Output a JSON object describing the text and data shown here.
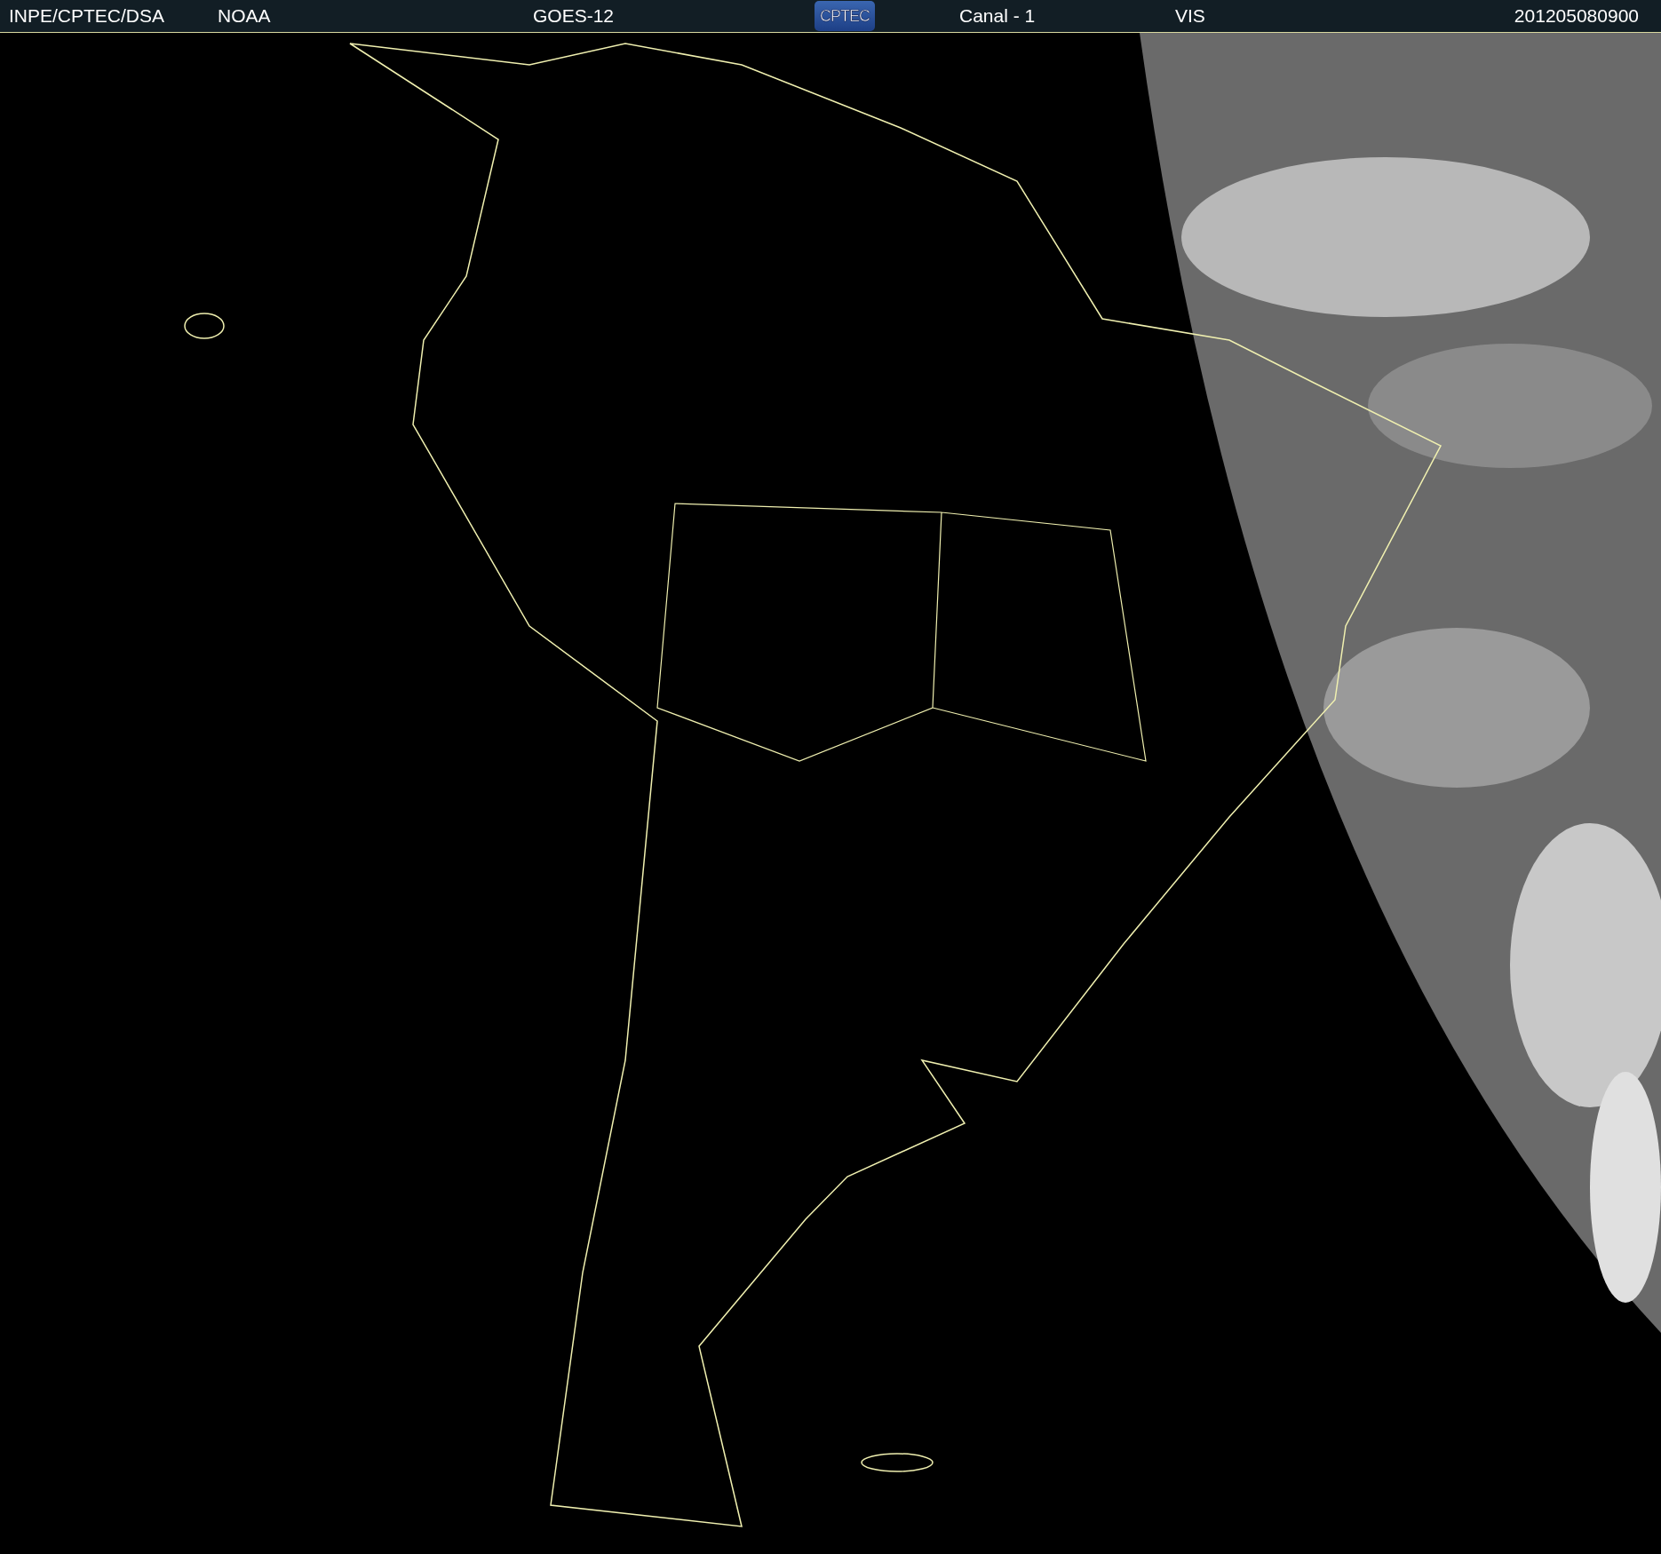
{
  "header": {
    "source": "INPE/CPTEC/DSA",
    "agency": "NOAA",
    "satellite": "GOES-12",
    "logo": "CPTEC",
    "channel": "Canal - 1",
    "band": "VIS",
    "timestamp": "201205080900"
  }
}
